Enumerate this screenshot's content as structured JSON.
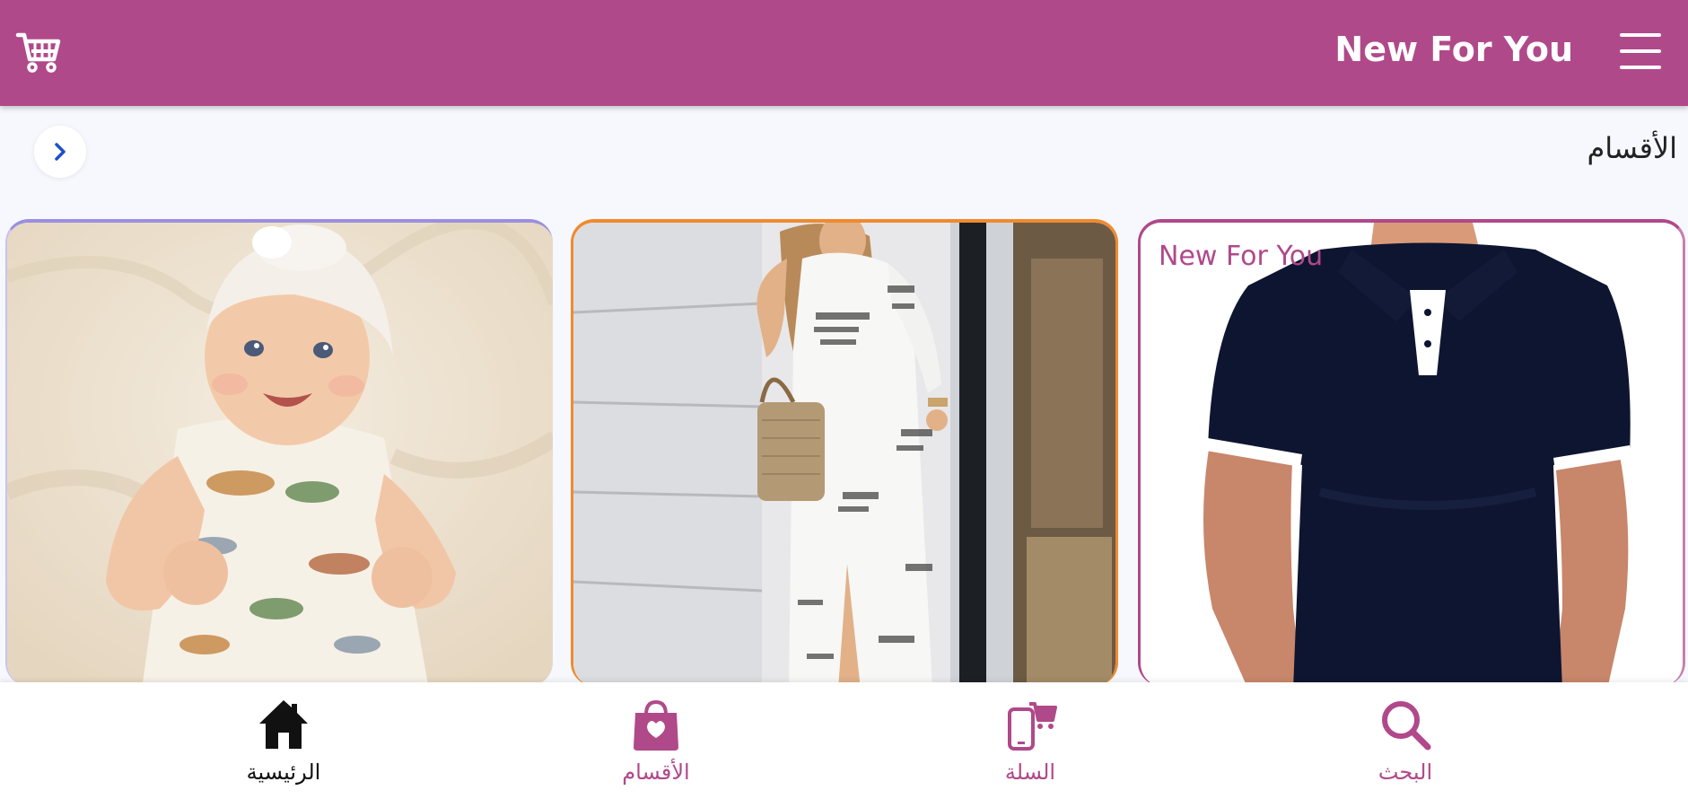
{
  "header": {
    "title": "New For You",
    "cart_icon": "cart-icon",
    "menu_icon": "hamburger-menu-icon"
  },
  "section": {
    "title": "الأقسام",
    "arrow_icon": "chevron-right-icon"
  },
  "cards": [
    {
      "name": "baby-outfit",
      "border_color": "#9b8ee0"
    },
    {
      "name": "women-dress",
      "border_color": "#f08a2e"
    },
    {
      "name": "men-polo",
      "label": "New For You",
      "border_color": "#b0498a"
    }
  ],
  "bottom_nav": {
    "items": [
      {
        "label": "الرئيسية",
        "icon": "home-icon",
        "color": "#111111",
        "active": true
      },
      {
        "label": "الأقسام",
        "icon": "shopping-bag-heart-icon",
        "color": "#b0498a"
      },
      {
        "label": "السلة",
        "icon": "phone-cart-icon",
        "color": "#b0498a"
      },
      {
        "label": "البحث",
        "icon": "search-icon",
        "color": "#b0498a"
      }
    ]
  },
  "colors": {
    "brand": "#b0498a",
    "background": "#f6f8fd",
    "nav_active": "#111111"
  }
}
